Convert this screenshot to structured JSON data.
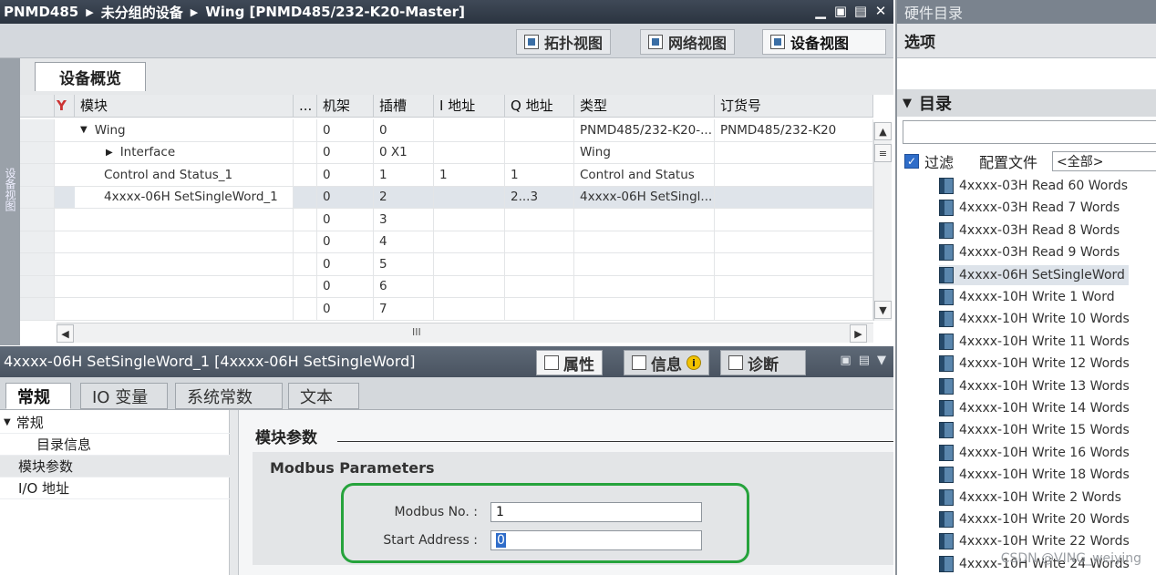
{
  "titlebar": {
    "crumbs": [
      "PNMD485",
      "未分组的设备",
      "Wing [PNMD485/232-K20-Master]"
    ],
    "sep": "▶",
    "controls": [
      "▁",
      "▣",
      "▤",
      "✕"
    ]
  },
  "views": {
    "topology": "拓扑视图",
    "network": "网络视图",
    "device": "设备视图",
    "active": "device"
  },
  "side_rail_label": "设备视图",
  "overview_tab": "设备概览",
  "grid": {
    "headers": {
      "module": "模块",
      "dots": "...",
      "rack": "机架",
      "slot": "插槽",
      "iaddr": "I 地址",
      "qaddr": "Q 地址",
      "type": "类型",
      "order": "订货号"
    },
    "rows": [
      {
        "caret": "▼",
        "module": "Wing",
        "rack": "0",
        "slot": "0",
        "iaddr": "",
        "qaddr": "",
        "type": "PNMD485/232-K20-...",
        "order": "PNMD485/232-K20"
      },
      {
        "caret": "▶",
        "module": "Interface",
        "rack": "0",
        "slot": "0 X1",
        "iaddr": "",
        "qaddr": "",
        "type": "Wing",
        "order": ""
      },
      {
        "caret": "",
        "module": "Control and Status_1",
        "rack": "0",
        "slot": "1",
        "iaddr": "1",
        "qaddr": "1",
        "type": "Control and Status",
        "order": ""
      },
      {
        "caret": "",
        "module": "4xxxx-06H SetSingleWord_1",
        "rack": "0",
        "slot": "2",
        "iaddr": "",
        "qaddr": "2...3",
        "type": "4xxxx-06H SetSingl...",
        "order": ""
      },
      {
        "caret": "",
        "module": "",
        "rack": "0",
        "slot": "3",
        "iaddr": "",
        "qaddr": "",
        "type": "",
        "order": ""
      },
      {
        "caret": "",
        "module": "",
        "rack": "0",
        "slot": "4",
        "iaddr": "",
        "qaddr": "",
        "type": "",
        "order": ""
      },
      {
        "caret": "",
        "module": "",
        "rack": "0",
        "slot": "5",
        "iaddr": "",
        "qaddr": "",
        "type": "",
        "order": ""
      },
      {
        "caret": "",
        "module": "",
        "rack": "0",
        "slot": "6",
        "iaddr": "",
        "qaddr": "",
        "type": "",
        "order": ""
      },
      {
        "caret": "",
        "module": "",
        "rack": "0",
        "slot": "7",
        "iaddr": "",
        "qaddr": "",
        "type": "",
        "order": ""
      }
    ],
    "scroll_mid": "III"
  },
  "inspector": {
    "title": "4xxxx-06H SetSingleWord_1 [4xxxx-06H SetSingleWord]",
    "tabs": {
      "properties": "属性",
      "info": "信息",
      "diagnostics": "诊断"
    },
    "info_badge": "i",
    "subtabs": [
      "常规",
      "IO 变量",
      "系统常数",
      "文本"
    ],
    "tree": {
      "general": "常规",
      "catalog_info": "目录信息",
      "module_params": "模块参数",
      "io_addr": "I/O 地址"
    },
    "section_title": "模块参数",
    "box_title": "Modbus Parameters",
    "fields": {
      "modbus_no_label": "Modbus No. :",
      "modbus_no_value": "1",
      "start_addr_label": "Start Address :",
      "start_addr_value": "0"
    }
  },
  "catalog": {
    "title": "硬件目录",
    "options": "选项",
    "directory": "目录",
    "filter_label": "过滤",
    "profile_label": "配置文件",
    "profile_value": "<全部>",
    "items": [
      "4xxxx-03H Read 60 Words",
      "4xxxx-03H Read 7 Words",
      "4xxxx-03H Read 8 Words",
      "4xxxx-03H Read 9 Words",
      "4xxxx-06H SetSingleWord",
      "4xxxx-10H Write 1 Word",
      "4xxxx-10H Write 10 Words",
      "4xxxx-10H Write 11 Words",
      "4xxxx-10H Write 12 Words",
      "4xxxx-10H Write 13 Words",
      "4xxxx-10H Write 14 Words",
      "4xxxx-10H Write 15 Words",
      "4xxxx-10H Write 16 Words",
      "4xxxx-10H Write 18 Words",
      "4xxxx-10H Write 2 Words",
      "4xxxx-10H Write 20 Words",
      "4xxxx-10H Write 22 Words",
      "4xxxx-10H Write 24 Words"
    ],
    "selected_index": 4
  },
  "watermark": "CSDN @VING_weiying",
  "colors": {
    "accent": "#2f6dc9",
    "highlight_ring": "#26a33c",
    "titlebar": "#2b3440"
  }
}
